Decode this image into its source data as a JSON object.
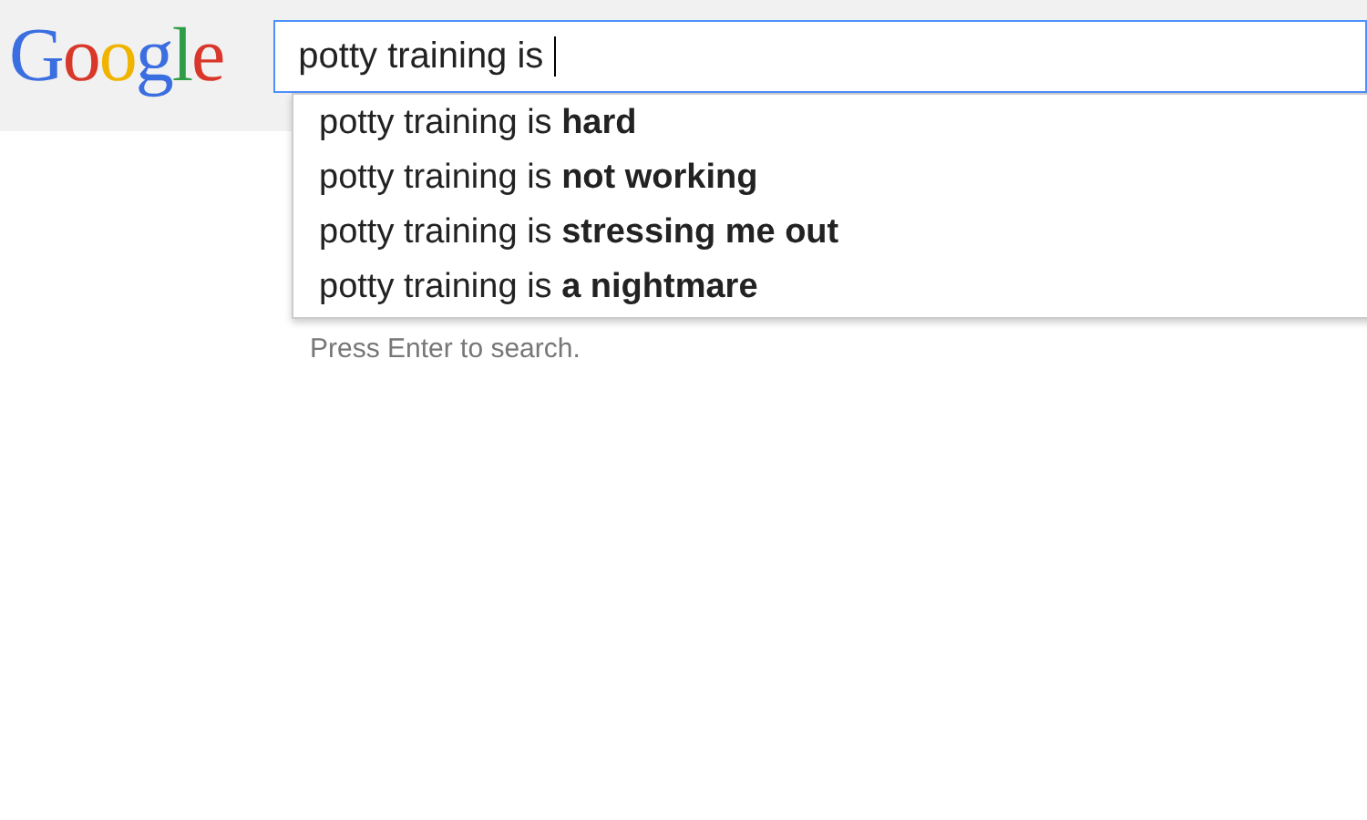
{
  "logo": {
    "text": "Google"
  },
  "search": {
    "value": "potty training is",
    "focused": true
  },
  "suggestions": [
    {
      "text": "potty training is **hard**",
      "selected": false
    },
    {
      "text": "potty training is **not working**",
      "selected": false
    },
    {
      "text": "potty training is **stressing me out**",
      "selected": false
    },
    {
      "text": "potty training is **a nightmare**",
      "selected": false
    }
  ],
  "hint": "Press Enter to search."
}
